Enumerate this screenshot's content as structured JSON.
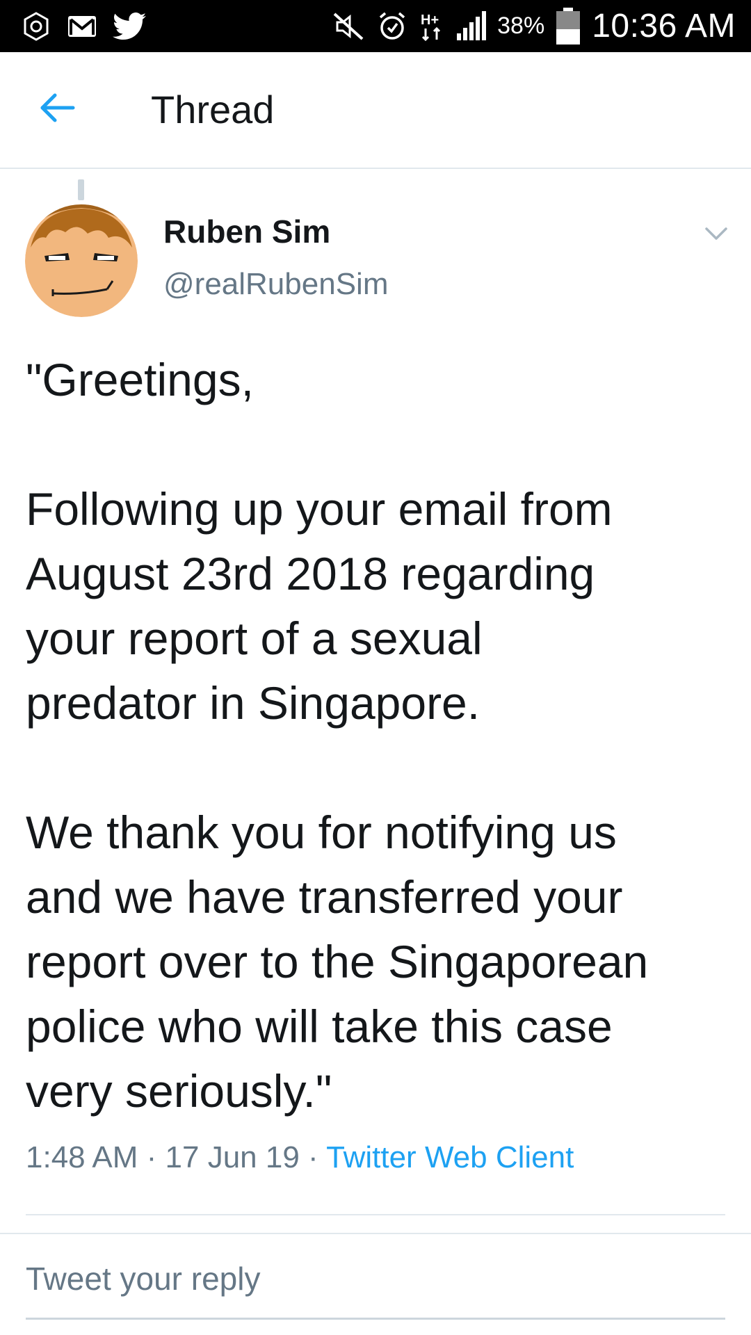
{
  "status_bar": {
    "battery_percent": "38%",
    "time": "10:36 AM",
    "left_icons": [
      "settings-icon",
      "gmail-icon",
      "twitter-icon"
    ],
    "right_icons": [
      "mute-icon",
      "alarm-icon",
      "network-hplus-icon",
      "signal-icon",
      "battery-icon"
    ]
  },
  "header": {
    "title": "Thread",
    "back_icon": "arrow-left-icon"
  },
  "tweet": {
    "author_name": "Ruben Sim",
    "author_handle": "@realRubenSim",
    "body": {
      "line1": "\"Greetings,",
      "line2": "Following up your email from",
      "line3": "August 23rd 2018 regarding",
      "line4": "your report of a sexual",
      "line5": "predator in Singapore.",
      "line6": "We thank you for notifying us",
      "line7": "and we have transferred your",
      "line8": "report over to the Singaporean",
      "line9": "police who will take this case",
      "line10": "very seriously.\""
    },
    "time": "1:48 AM",
    "sep1": " · ",
    "date": "17 Jun 19",
    "sep2": " · ",
    "client": "Twitter Web Client"
  },
  "reply": {
    "placeholder": "Tweet your reply"
  },
  "colors": {
    "accent": "#1da1f2",
    "secondary_text": "#657786",
    "primary_text": "#14171a",
    "divider": "#e1e8ed"
  }
}
